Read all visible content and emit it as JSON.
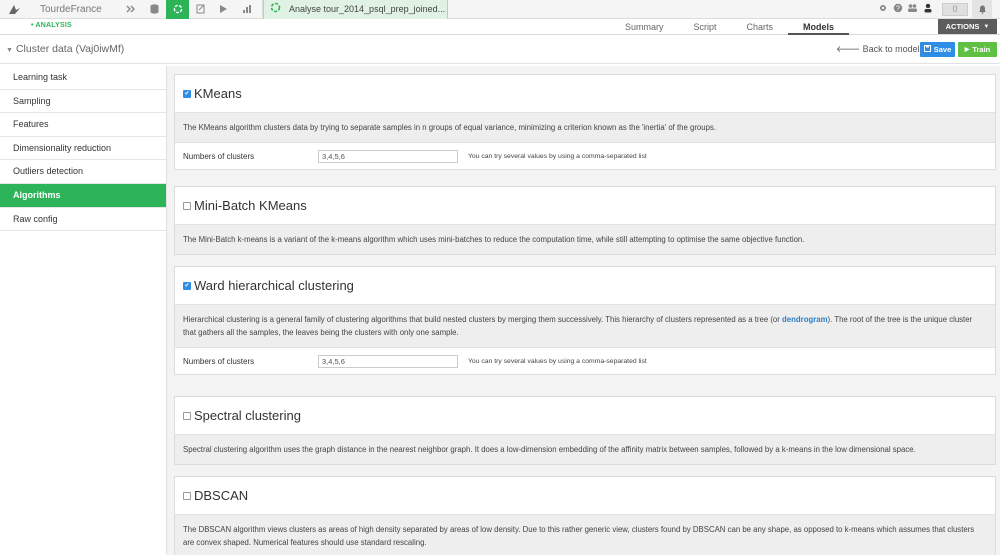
{
  "topbar": {
    "project_name": "TourdeFrance",
    "analysis_tab_label": "Analyse tour_2014_psql_prep_joined...",
    "notification_count": "0",
    "icons": [
      "bird-logo-icon",
      "flow-icon",
      "database-icon",
      "analysis-icon",
      "notebook-icon",
      "run-icon",
      "chart-icon",
      "gear-icon",
      "help-icon",
      "users-icon",
      "user-icon",
      "bell-icon"
    ]
  },
  "subbar": {
    "analysis_label": "• ANALYSIS",
    "tabs": [
      {
        "label": "Summary"
      },
      {
        "label": "Script"
      },
      {
        "label": "Charts"
      },
      {
        "label": "Models"
      }
    ],
    "active_tab": "Models",
    "actions_label": "ACTIONS"
  },
  "thirdbar": {
    "title": "Cluster data (Vaj0iwMf)",
    "back_label": "Back to models list",
    "save_label": "Save",
    "train_label": "Train"
  },
  "sidebar": {
    "items": [
      {
        "label": "Learning task"
      },
      {
        "label": "Sampling"
      },
      {
        "label": "Features"
      },
      {
        "label": "Dimensionality reduction"
      },
      {
        "label": "Outliers detection"
      },
      {
        "label": "Algorithms"
      },
      {
        "label": "Raw config"
      }
    ],
    "active_item": "Algorithms"
  },
  "algorithms": [
    {
      "title": "KMeans",
      "enabled": true,
      "description": "The KMeans algorithm clusters data by trying to separate samples in n groups of equal variance, minimizing a criterion known as the 'inertia' of the groups.",
      "param_label": "Numbers of clusters",
      "param_value": "3,4,5,6",
      "param_hint": "You can try several values by using a comma-separated list"
    },
    {
      "title": "Mini-Batch KMeans",
      "enabled": false,
      "description": "The Mini-Batch k-means is a variant of the k-means algorithm which uses mini-batches to reduce the computation time, while still attempting to optimise the same objective function."
    },
    {
      "title": "Ward hierarchical clustering",
      "enabled": true,
      "description_pre": "Hierarchical clustering is a general family of clustering algorithms that build nested clusters by merging them successively. This hierarchy of clusters represented as a tree (or ",
      "description_link": "dendrogram",
      "description_post": "). The root of the tree is the unique cluster that gathers all the samples, the leaves being the clusters with only one sample.",
      "param_label": "Numbers of clusters",
      "param_value": "3,4,5,6",
      "param_hint": "You can try several values by using a comma-separated list"
    },
    {
      "title": "Spectral clustering",
      "enabled": false,
      "description": "Spectral clustering algorithm uses the graph distance in the nearest neighbor graph. It does a low-dimension embedding of the affinity matrix between samples, followed by a k-means in the low dimensional space."
    },
    {
      "title": "DBSCAN",
      "enabled": false,
      "description": "The DBSCAN algorithm views clusters as areas of high density separated by areas of low density. Due to this rather generic view, clusters found by DBSCAN can be any shape, as opposed to k-means which assumes that clusters are convex shaped. Numerical features should use standard rescaling."
    }
  ],
  "colors": {
    "accent_green": "#2db358",
    "save_blue": "#2e8ee6",
    "train_green": "#5fc044",
    "actions_gray": "#5d5d5d"
  }
}
